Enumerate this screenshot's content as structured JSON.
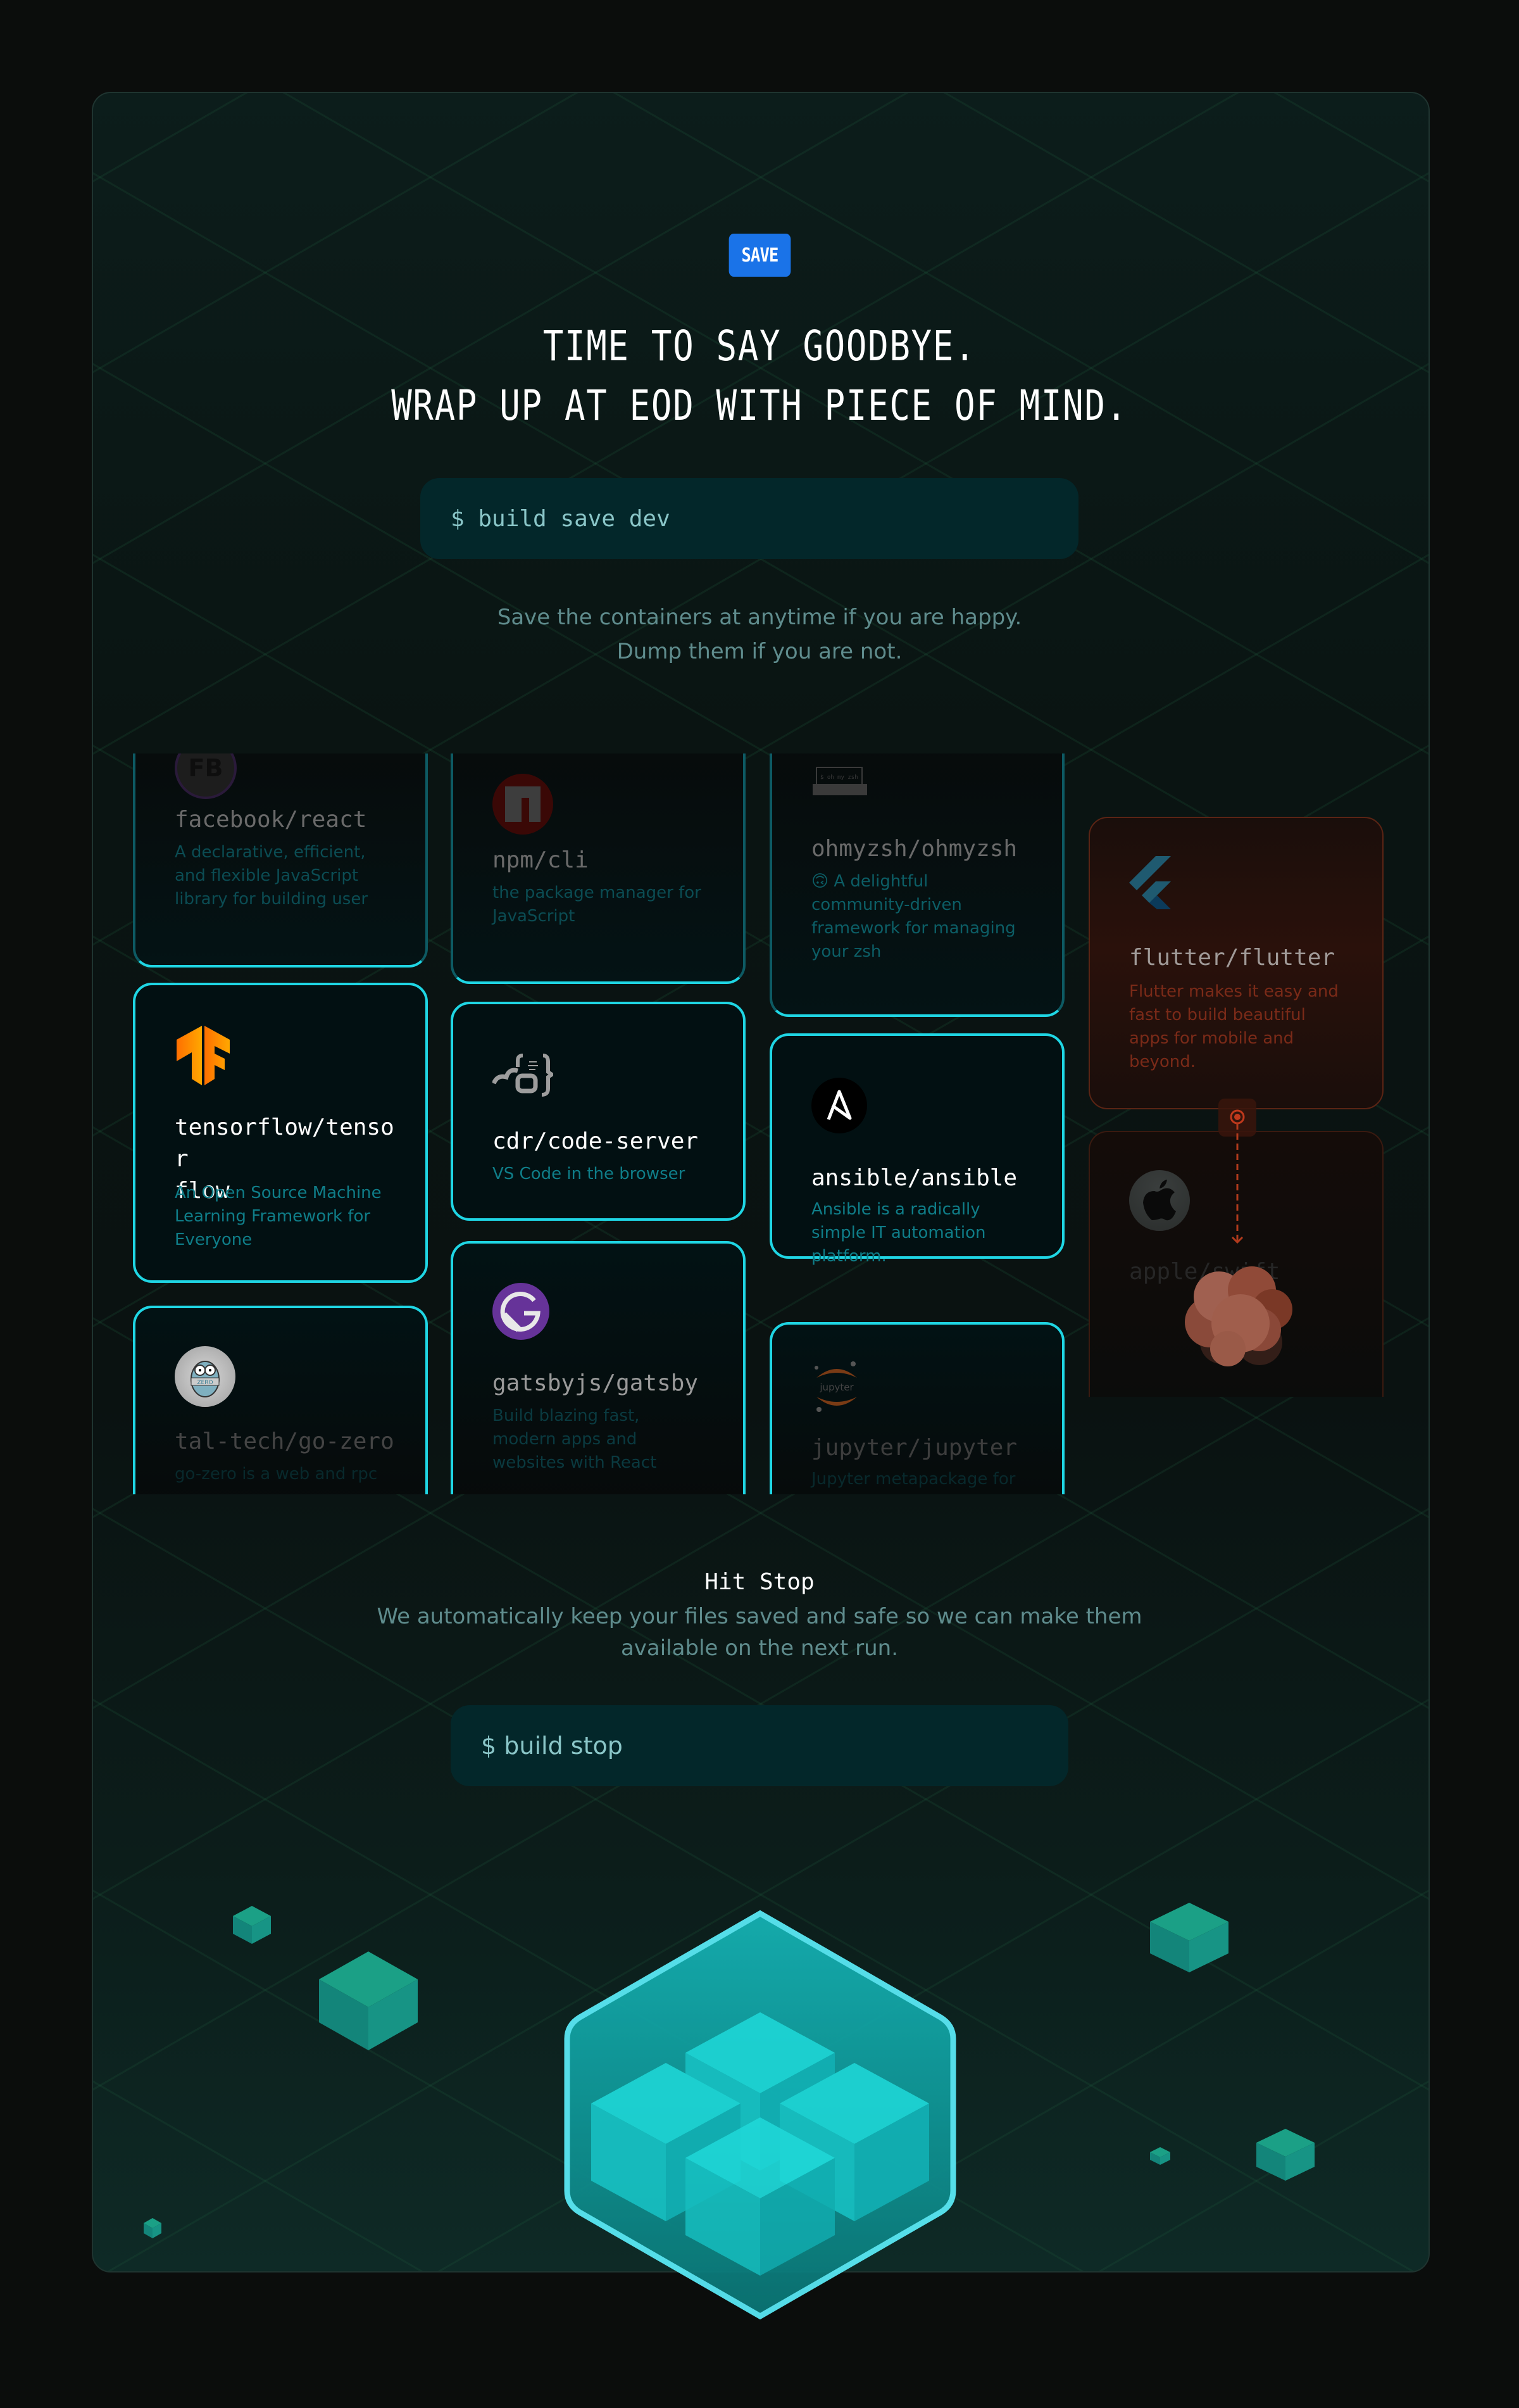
{
  "badge": {
    "label": "SAVE",
    "color": "#1a73e8"
  },
  "headline": {
    "line1": "TIME TO SAY GOODBYE.",
    "line2": "WRAP UP AT EOD WITH PIECE OF MIND."
  },
  "save_command": {
    "text": "$ build save dev"
  },
  "save_description": {
    "line1": "Save the containers at anytime if you are happy.",
    "line2": "Dump them if you are not."
  },
  "repos": [
    {
      "name": "facebook/react",
      "description": "A declarative, efficient, and flexible JavaScript library for building user",
      "icon": "facebook-icon"
    },
    {
      "name": "npm/cli",
      "description": "the package manager for JavaScript",
      "icon": "npm-icon"
    },
    {
      "name": "ohmyzsh/ohmyzsh",
      "description": "🙃 A delightful community-driven framework for managing your zsh",
      "icon": "ohmyzsh-icon"
    },
    {
      "name": "tensorflow/tensorflow",
      "name_line1": "tensorflow/tensor",
      "name_line2": "flow",
      "description": "An Open Source Machine Learning Framework for Everyone",
      "icon": "tensorflow-icon"
    },
    {
      "name": "cdr/code-server",
      "description": "VS Code in the browser",
      "icon": "code-server-icon"
    },
    {
      "name": "ansible/ansible",
      "description": "Ansible is a radically simple IT automation platform.",
      "icon": "ansible-icon"
    },
    {
      "name": "tal-tech/go-zero",
      "description": "go-zero is a web and rpc",
      "icon": "go-zero-icon"
    },
    {
      "name": "gatsbyjs/gatsby",
      "description": "Build blazing fast, modern apps and websites with React",
      "icon": "gatsby-icon"
    },
    {
      "name": "jupyter/jupyter",
      "description": "Jupyter metapackage for",
      "icon": "jupyter-icon"
    },
    {
      "name": "flutter/flutter",
      "description": "Flutter makes it easy and fast to build beautiful apps for mobile and beyond.",
      "icon": "flutter-icon",
      "state": "discarded"
    },
    {
      "name": "apple/swift",
      "description": "",
      "icon": "apple-icon",
      "state": "discarded"
    }
  ],
  "ohmyzsh_logo_text": "$ oh my zsh",
  "gozero_logo_text": "ZERO",
  "jupyter_logo_text": "jupyter",
  "stop_section": {
    "title": "Hit Stop",
    "description_line1": "We automatically keep your files saved and safe so we can make them",
    "description_line2": "available on the next run.",
    "command": "$ build stop"
  },
  "colors": {
    "accent_cyan": "#1fd6e4",
    "discard_red": "#c0391c",
    "cube_teal": "#1a9e88"
  }
}
